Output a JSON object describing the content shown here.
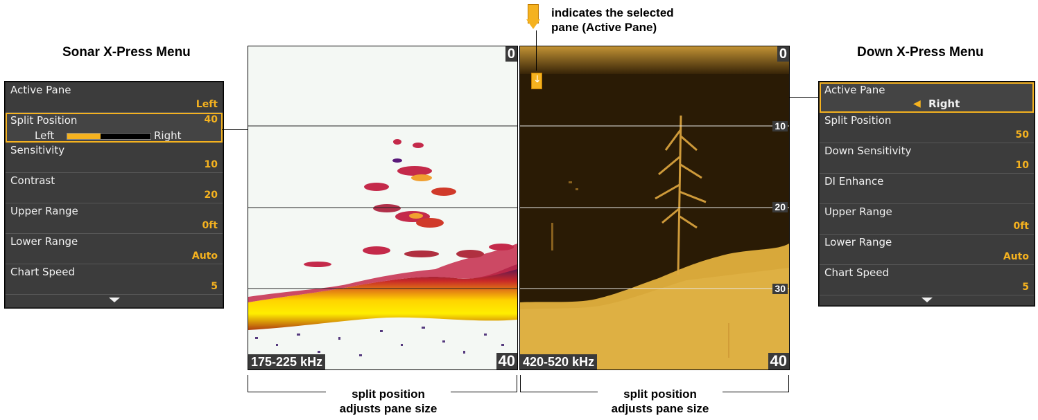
{
  "left_menu": {
    "title": "Sonar X-Press Menu",
    "items": [
      {
        "label": "Active Pane",
        "value": "Left"
      },
      {
        "label": "Split Position",
        "value": "40",
        "slider_left": "Left",
        "slider_right": "Right",
        "slider_level": 0.4
      },
      {
        "label": "Sensitivity",
        "value": "10"
      },
      {
        "label": "Contrast",
        "value": "20"
      },
      {
        "label": "Upper Range",
        "value": "0ft"
      },
      {
        "label": "Lower Range",
        "value": "Auto"
      },
      {
        "label": "Chart Speed",
        "value": "5"
      }
    ]
  },
  "right_menu": {
    "title": "Down X-Press Menu",
    "items": [
      {
        "label": "Active Pane",
        "value": "Right"
      },
      {
        "label": "Split Position",
        "value": "50"
      },
      {
        "label": "Down Sensitivity",
        "value": "10"
      },
      {
        "label": "DI Enhance",
        "value": ""
      },
      {
        "label": "Upper Range",
        "value": "0ft"
      },
      {
        "label": "Lower Range",
        "value": "Auto"
      },
      {
        "label": "Chart Speed",
        "value": "5"
      }
    ]
  },
  "left_pane": {
    "frequency": "175-225 kHz",
    "depth_top": "0",
    "depth_bottom": "40"
  },
  "right_pane": {
    "frequency": "420-520 kHz",
    "depth_top": "0",
    "depth_bottom": "40",
    "ticks": [
      "10",
      "20",
      "30"
    ]
  },
  "annotation": {
    "line1": "indicates the selected",
    "line2": "pane (Active Pane)"
  },
  "bracket_label": {
    "line1": "split position",
    "line2": "adjusts pane size"
  },
  "colors": {
    "accent": "#f5b21f",
    "menu_bg": "#3c3c3c"
  }
}
